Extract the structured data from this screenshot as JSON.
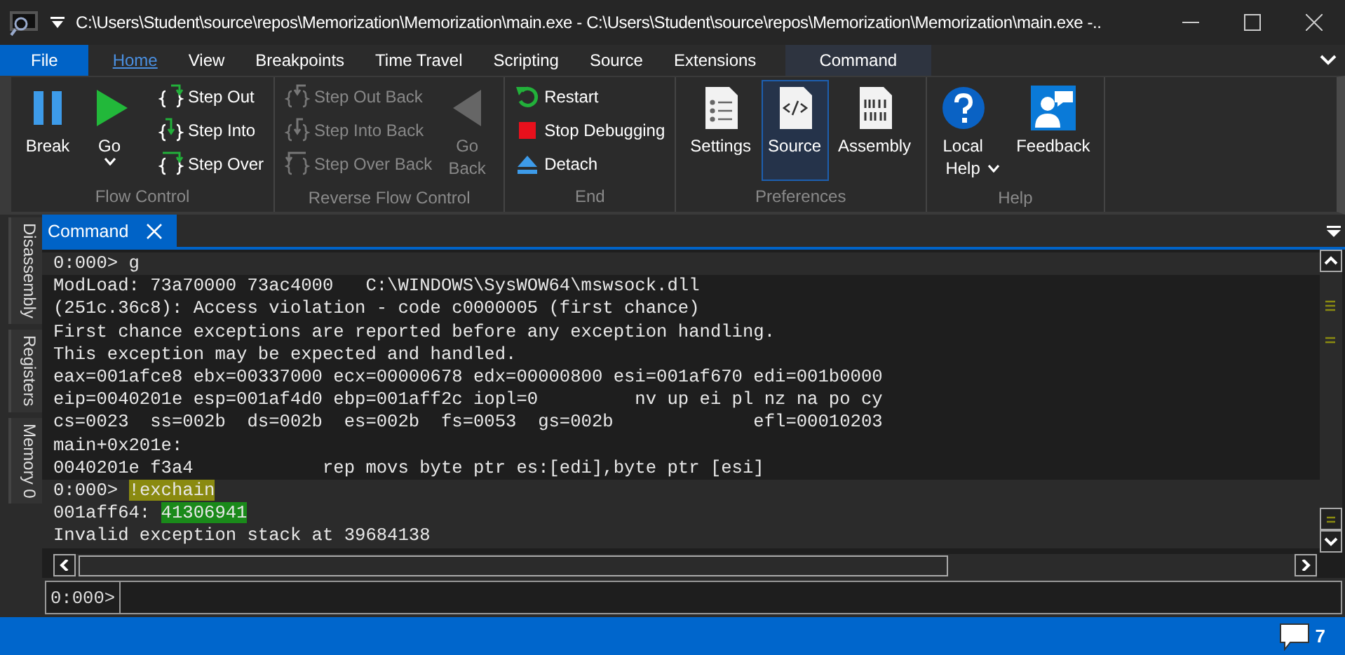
{
  "window": {
    "title": "C:\\Users\\Student\\source\\repos\\Memorization\\Memorization\\main.exe - C:\\Users\\Student\\source\\repos\\Memorization\\Memorization\\main.exe  -.."
  },
  "menu_tabs": [
    {
      "label": "File",
      "kind": "file",
      "selected": false
    },
    {
      "label": "Home",
      "kind": "tab",
      "selected": true
    },
    {
      "label": "View",
      "kind": "tab",
      "selected": false
    },
    {
      "label": "Breakpoints",
      "kind": "tab",
      "selected": false
    },
    {
      "label": "Time Travel",
      "kind": "tab",
      "selected": false
    },
    {
      "label": "Scripting",
      "kind": "tab",
      "selected": false
    },
    {
      "label": "Source",
      "kind": "tab",
      "selected": false
    },
    {
      "label": "Extensions",
      "kind": "tab",
      "selected": false
    },
    {
      "label": "Command",
      "kind": "context",
      "selected": false
    }
  ],
  "ribbon": {
    "groups": [
      {
        "label": "Flow Control",
        "buttons": [
          {
            "label": "Break",
            "kind": "large",
            "disabled": false,
            "selected": false,
            "dropdown": false
          },
          {
            "label": "Go",
            "kind": "large",
            "disabled": false,
            "selected": false,
            "dropdown": true
          },
          {
            "label": "Step Out",
            "kind": "small",
            "disabled": false
          },
          {
            "label": "Step Into",
            "kind": "small",
            "disabled": false
          },
          {
            "label": "Step Over",
            "kind": "small",
            "disabled": false
          }
        ]
      },
      {
        "label": "Reverse Flow Control",
        "buttons": [
          {
            "label": "Step Out Back",
            "kind": "small",
            "disabled": true
          },
          {
            "label": "Step Into Back",
            "kind": "small",
            "disabled": true
          },
          {
            "label": "Step Over Back",
            "kind": "small",
            "disabled": true
          },
          {
            "label": "Go Back",
            "kind": "large",
            "disabled": true,
            "selected": false,
            "dropdown": false
          }
        ]
      },
      {
        "label": "End",
        "buttons": [
          {
            "label": "Restart",
            "kind": "small",
            "disabled": false
          },
          {
            "label": "Stop Debugging",
            "kind": "small",
            "disabled": false
          },
          {
            "label": "Detach",
            "kind": "small",
            "disabled": false
          }
        ]
      },
      {
        "label": "Preferences",
        "buttons": [
          {
            "label": "Settings",
            "kind": "large",
            "disabled": false,
            "selected": false,
            "dropdown": false
          },
          {
            "label": "Source",
            "kind": "large",
            "disabled": false,
            "selected": true,
            "dropdown": false
          },
          {
            "label": "Assembly",
            "kind": "large",
            "disabled": false,
            "selected": false,
            "dropdown": false
          }
        ]
      },
      {
        "label": "Help",
        "buttons": [
          {
            "label": "Local Help",
            "kind": "large",
            "disabled": false,
            "selected": false,
            "dropdown": true
          },
          {
            "label": "Feedback",
            "kind": "large",
            "disabled": false,
            "selected": false,
            "dropdown": false
          }
        ]
      }
    ]
  },
  "side_tabs": [
    {
      "label": "Disassembly"
    },
    {
      "label": "Registers"
    },
    {
      "label": "Memory 0"
    }
  ],
  "dock_tabs": [
    {
      "label": "Command",
      "selected": true
    }
  ],
  "console": {
    "blocks": [
      {
        "prompt": "0:000>",
        "command": [
          {
            "text": "g"
          }
        ],
        "current": false,
        "output": [
          [
            {
              "text": "ModLoad: 73a70000 73ac4000   C:\\WINDOWS\\SysWOW64\\mswsock.dll"
            }
          ],
          [
            {
              "text": "(251c.36c8): Access violation - code c0000005 (first chance)"
            }
          ],
          [
            {
              "text": "First chance exceptions are reported before any exception handling."
            }
          ],
          [
            {
              "text": "This exception may be expected and handled."
            }
          ],
          [
            {
              "text": "eax=001afce8 ebx=00337000 ecx=00000678 edx=00000800 esi=001af670 edi=001b0000"
            }
          ],
          [
            {
              "text": "eip=0040201e esp=001af4d0 ebp=001aff2c iopl=0         nv up ei pl nz na po cy"
            }
          ],
          [
            {
              "text": "cs=0023  ss=002b  ds=002b  es=002b  fs=0053  gs=002b             efl=00010203"
            }
          ],
          [
            {
              "text": "main+0x201e:"
            }
          ],
          [
            {
              "text": "0040201e f3a4            rep movs byte ptr es:[edi],byte ptr [esi]"
            }
          ]
        ]
      },
      {
        "prompt": "0:000>",
        "command": [
          {
            "text": "!exchain",
            "color": "#8a8a10"
          }
        ],
        "current": true,
        "output": [
          [
            {
              "text": "001aff64: "
            },
            {
              "text": "41306941",
              "color": "#1a8a1a"
            }
          ],
          [
            {
              "text": "Invalid exception stack at 39684138"
            }
          ]
        ]
      }
    ]
  },
  "command_input": {
    "prompt": "0:000>"
  },
  "status_bar": {
    "notifications": "7"
  }
}
